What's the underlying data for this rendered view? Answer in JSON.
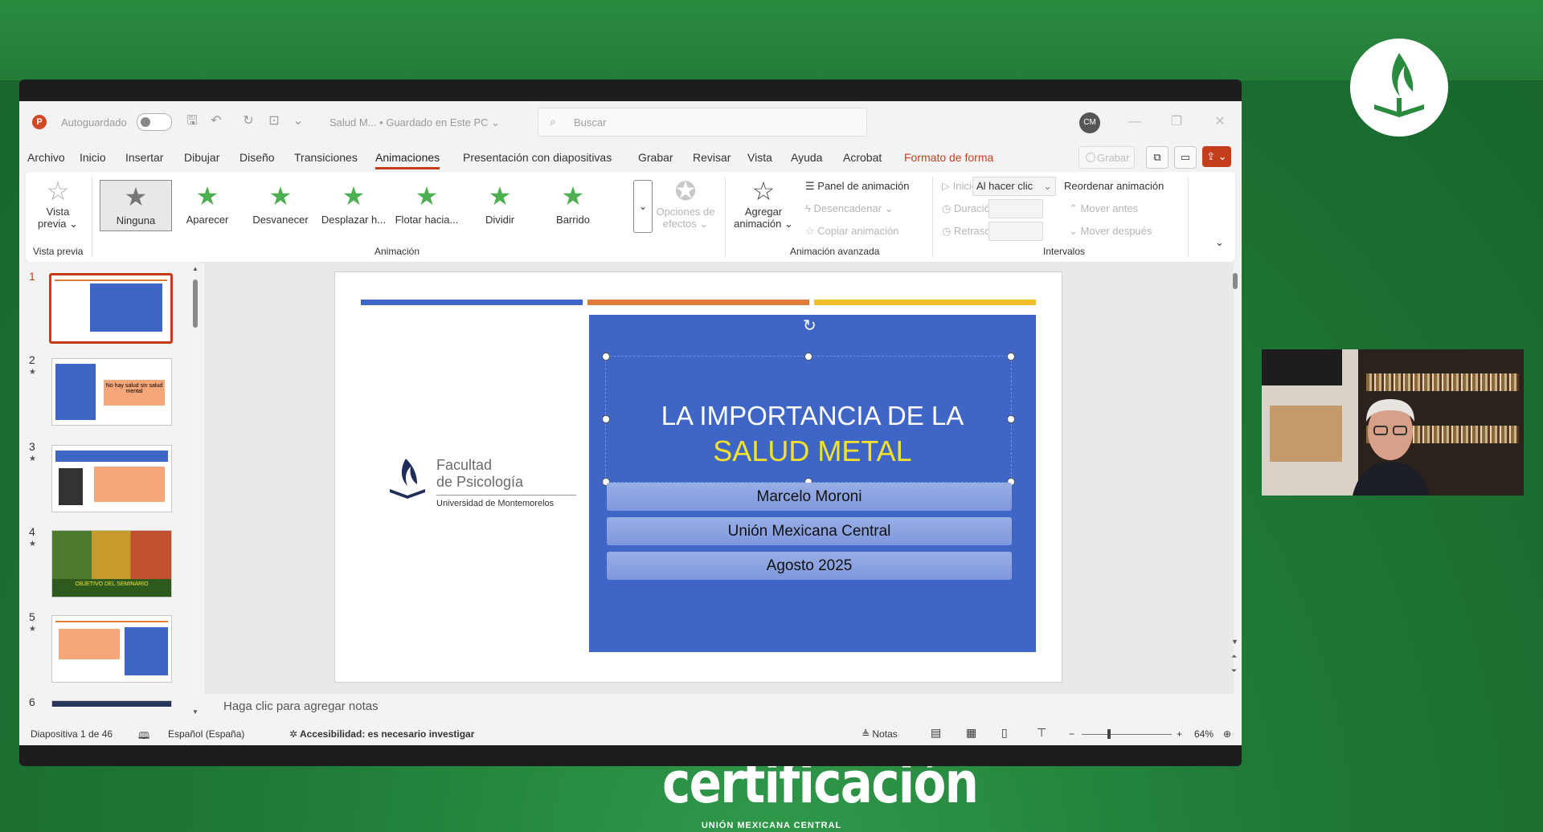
{
  "app": {
    "autosave_label": "Autoguardado",
    "doc_title": "Salud M...",
    "doc_saved": "• Guardado en Este PC",
    "search_placeholder": "Buscar",
    "user_initials": "CM",
    "menu": [
      "Archivo",
      "Inicio",
      "Insertar",
      "Dibujar",
      "Diseño",
      "Transiciones",
      "Animaciones",
      "Presentación con diapositivas",
      "Grabar",
      "Revisar",
      "Vista",
      "Ayuda",
      "Acrobat",
      "Formato de forma"
    ],
    "active_menu": "Animaciones",
    "record_button": "Grabar"
  },
  "ribbon": {
    "preview_label_1": "Vista",
    "preview_label_2": "previa",
    "preview_group": "Vista previa",
    "animations": [
      "Ninguna",
      "Aparecer",
      "Desvanecer",
      "Desplazar h...",
      "Flotar hacia...",
      "Dividir",
      "Barrido"
    ],
    "selected_animation": "Ninguna",
    "effect_options_1": "Opciones de",
    "effect_options_2": "efectos",
    "animation_group": "Animación",
    "add_animation_1": "Agregar",
    "add_animation_2": "animación",
    "animation_panel": "Panel de animación",
    "trigger": "Desencadenar",
    "copy_animation": "Copiar animación",
    "advanced_group": "Animación avanzada",
    "start_label": "Inicio:",
    "start_value": "Al hacer clic",
    "duration_label": "Duración:",
    "delay_label": "Retraso:",
    "reorder_label": "Reordenar animación",
    "move_earlier": "Mover antes",
    "move_later": "Mover después",
    "timing_group": "Intervalos"
  },
  "slides_panel": {
    "numbers": [
      "1",
      "2",
      "3",
      "4",
      "5",
      "6"
    ],
    "active": "1",
    "thumb2_text": "No hay salud sin salud mental",
    "thumb4_text": "OBJETIVO DEL SEMINARIO"
  },
  "slide": {
    "title_line1": "LA IMPORTANCIA DE LA",
    "title_line2": "SALUD METAL",
    "presenter": "Marcelo Moroni",
    "organization": "Unión Mexicana Central",
    "date": "Agosto 2025",
    "faculty_line1": "Facultad",
    "faculty_line2": "de Psicología",
    "university": "Universidad de Montemorelos",
    "bar_colors": [
      "#3f66c7",
      "#e07b39",
      "#f2c02b"
    ],
    "box_color": "#3f66c7",
    "title_accent": "#f2e22b"
  },
  "notes_placeholder": "Haga clic para agregar notas",
  "status": {
    "slide_count": "Diapositiva 1 de 46",
    "language": "Español (España)",
    "accessibility": "Accesibilidad: es necesario investigar",
    "notes_button": "Notas",
    "zoom": "64%"
  },
  "overlay": {
    "title": "certificación",
    "subtitle": "UNIÓN MEXICANA CENTRAL"
  },
  "colors": {
    "accent": "#c43e1c",
    "background_green": "#1f7a37"
  }
}
